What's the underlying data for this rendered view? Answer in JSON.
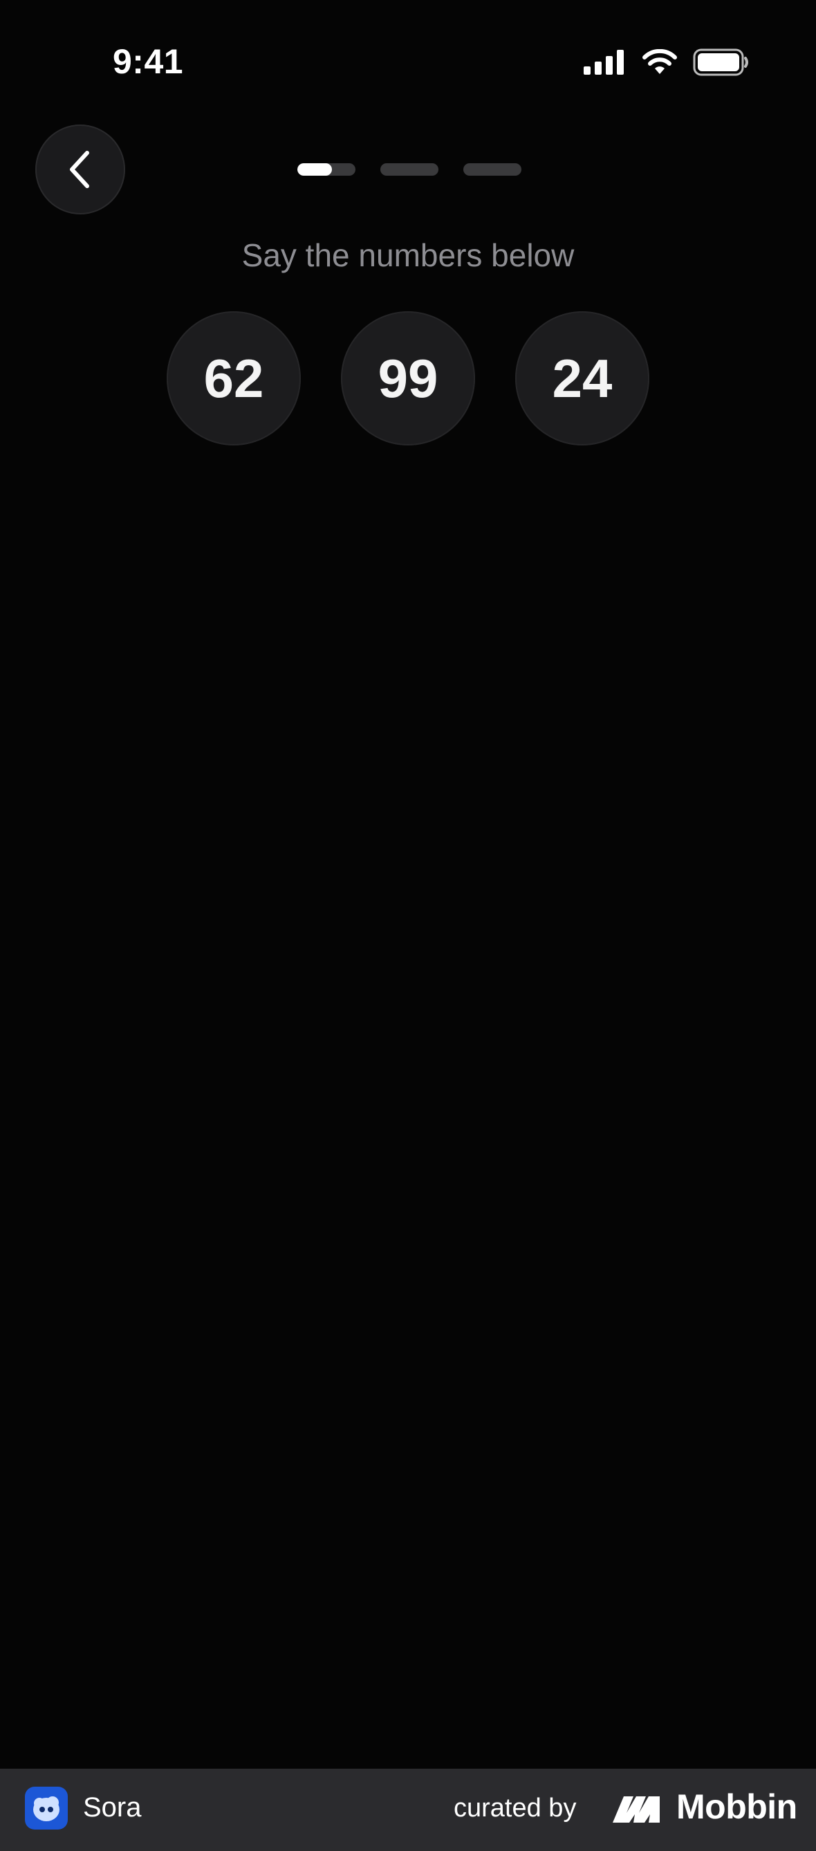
{
  "status_bar": {
    "time": "9:41",
    "icons": [
      "signal-icon",
      "wifi-icon",
      "battery-icon"
    ]
  },
  "nav": {
    "back_icon": "chevron-left-icon"
  },
  "progress": {
    "total_steps": 3,
    "current_step": 1,
    "current_step_fill": 0.6
  },
  "prompt": "Say the numbers below",
  "numbers": [
    "62",
    "99",
    "24"
  ],
  "footer": {
    "app_name": "Sora",
    "curated_by": "curated by",
    "brand": "Mobbin"
  },
  "colors": {
    "background": "#050505",
    "bubble": "#1c1c1e",
    "prompt_text": "#8e8e93",
    "footer_bg": "#2b2b2e",
    "app_icon": "#1c57d6"
  }
}
